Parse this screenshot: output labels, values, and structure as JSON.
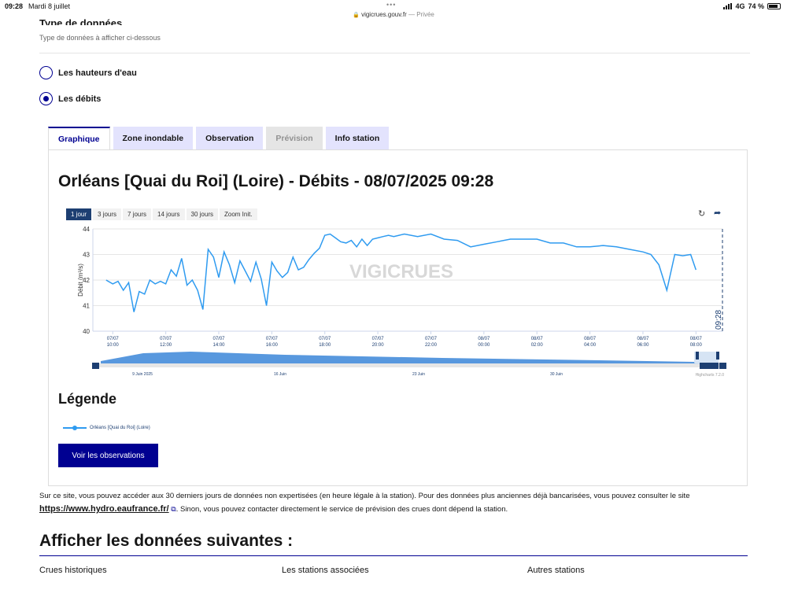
{
  "status_bar": {
    "time": "09:28",
    "date": "Mardi 8 juillet",
    "dots": "•••",
    "url": "vigicrues.gouv.fr",
    "mode": "— Privée",
    "network": "4G",
    "battery": "74 %"
  },
  "section": {
    "title": "Type de données",
    "hint": "Type de données à afficher ci-dessous"
  },
  "radios": [
    {
      "label": "Les hauteurs d'eau",
      "checked": false
    },
    {
      "label": "Les débits",
      "checked": true
    }
  ],
  "tabs": [
    {
      "label": "Graphique",
      "state": "active"
    },
    {
      "label": "Zone inondable",
      "state": "normal"
    },
    {
      "label": "Observation",
      "state": "normal"
    },
    {
      "label": "Prévision",
      "state": "disabled"
    },
    {
      "label": "Info station",
      "state": "normal"
    }
  ],
  "chart": {
    "title": "Orléans [Quai du Roi] (Loire) - Débits - 08/07/2025 09:28",
    "range_buttons": [
      "1 jour",
      "3 jours",
      "7 jours",
      "14 jours",
      "30 jours",
      "Zoom Init."
    ],
    "active_range": "1 jour",
    "reset_icon": "refresh-icon",
    "share_icon": "share-arrow-icon",
    "watermark": "VIGICRUES",
    "current_marker_label": "09:28",
    "credits": "Highcharts 7.2.0",
    "navigator_labels": [
      "9 Juin 2025",
      "16 Juin",
      "23 Juin",
      "30 Juin"
    ]
  },
  "chart_data": {
    "type": "line",
    "title": "Orléans [Quai du Roi] (Loire) - Débits - 08/07/2025 09:28",
    "ylabel": "Débit (m³/s)",
    "xlabel": "",
    "ylim": [
      40,
      44
    ],
    "yticks": [
      40,
      41,
      42,
      43,
      44
    ],
    "xlim": [
      9.83,
      9.83
    ],
    "xticks": [
      {
        "date": "07/07",
        "time": "10:00",
        "h": 10
      },
      {
        "date": "07/07",
        "time": "12:00",
        "h": 12
      },
      {
        "date": "07/07",
        "time": "14:00",
        "h": 14
      },
      {
        "date": "07/07",
        "time": "16:00",
        "h": 16
      },
      {
        "date": "07/07",
        "time": "18:00",
        "h": 18
      },
      {
        "date": "07/07",
        "time": "20:00",
        "h": 20
      },
      {
        "date": "07/07",
        "time": "22:00",
        "h": 22
      },
      {
        "date": "08/07",
        "time": "00:00",
        "h": 24
      },
      {
        "date": "08/07",
        "time": "02:00",
        "h": 26
      },
      {
        "date": "08/07",
        "time": "04:00",
        "h": 28
      },
      {
        "date": "08/07",
        "time": "06:00",
        "h": 30
      },
      {
        "date": "08/07",
        "time": "08:00",
        "h": 32
      }
    ],
    "grid": true,
    "legend_position": "bottom-left",
    "series": [
      {
        "name": "Orléans [Quai du Roi] (Loire)",
        "color": "#2f9bf0",
        "x": [
          9.75,
          10.0,
          10.2,
          10.4,
          10.6,
          10.8,
          11.0,
          11.2,
          11.4,
          11.6,
          11.8,
          12.0,
          12.2,
          12.4,
          12.6,
          12.8,
          13.0,
          13.2,
          13.4,
          13.6,
          13.8,
          14.0,
          14.2,
          14.4,
          14.6,
          14.8,
          15.0,
          15.2,
          15.4,
          15.6,
          15.8,
          16.0,
          16.2,
          16.4,
          16.6,
          16.8,
          17.0,
          17.2,
          17.4,
          17.6,
          17.8,
          18.0,
          18.2,
          18.4,
          18.6,
          18.8,
          19.0,
          19.2,
          19.4,
          19.6,
          19.8,
          20.0,
          20.2,
          20.4,
          20.6,
          20.8,
          21.0,
          21.5,
          22.0,
          22.5,
          23.0,
          23.5,
          24.0,
          24.5,
          25.0,
          25.5,
          26.0,
          26.5,
          27.0,
          27.5,
          28.0,
          28.5,
          29.0,
          29.5,
          30.0,
          30.3,
          30.6,
          30.9,
          31.2,
          31.5,
          31.8,
          32.0
        ],
        "values": [
          42.0,
          41.85,
          41.95,
          41.6,
          41.9,
          40.75,
          41.55,
          41.45,
          42.0,
          41.85,
          41.95,
          41.85,
          42.4,
          42.15,
          42.85,
          41.8,
          42.0,
          41.6,
          40.85,
          43.2,
          42.9,
          42.1,
          43.1,
          42.6,
          41.9,
          42.75,
          42.35,
          41.95,
          42.7,
          42.05,
          41.0,
          42.7,
          42.35,
          42.1,
          42.3,
          42.9,
          42.4,
          42.5,
          42.8,
          43.05,
          43.25,
          43.75,
          43.8,
          43.65,
          43.5,
          43.45,
          43.55,
          43.3,
          43.6,
          43.35,
          43.6,
          43.65,
          43.7,
          43.75,
          43.7,
          43.75,
          43.8,
          43.7,
          43.8,
          43.6,
          43.55,
          43.3,
          43.4,
          43.5,
          43.6,
          43.6,
          43.6,
          43.45,
          43.45,
          43.3,
          43.3,
          43.35,
          43.3,
          43.2,
          43.1,
          43.0,
          42.6,
          41.6,
          43.0,
          42.95,
          43.0,
          42.4
        ]
      }
    ]
  },
  "legend": {
    "title": "Légende",
    "item": "Orléans [Quai du Roi] (Loire)"
  },
  "observations_button": "Voir les observations",
  "info": {
    "text1": "Sur ce site, vous pouvez accéder aux 30 derniers jours de données non expertisées (en heure légale à la station). Pour des données plus anciennes déjà bancarisées, vous pouvez consulter le site",
    "link": "https://www.hydro.eaufrance.fr/",
    "text2": ". Sinon, vous pouvez contacter directement le service de prévision des crues dont dépend la station."
  },
  "data_section": {
    "title": "Afficher les données suivantes :",
    "columns": [
      "Crues historiques",
      "Les stations associées",
      "Autres stations"
    ]
  }
}
